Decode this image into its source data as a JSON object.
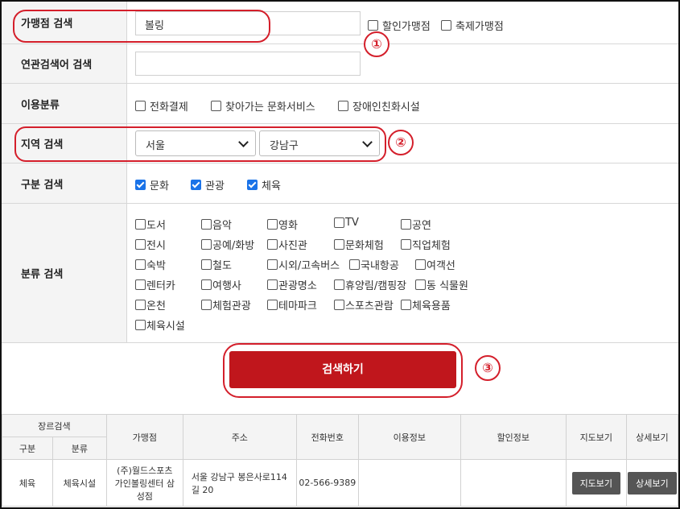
{
  "form": {
    "merchant": {
      "label": "가맹점 검색",
      "value": "볼링",
      "options": [
        "할인가맹점",
        "축제가맹점"
      ]
    },
    "related": {
      "label": "연관검색어 검색",
      "value": ""
    },
    "usage": {
      "label": "이용분류",
      "options": [
        "전화결제",
        "찾아가는 문화서비스",
        "장애인친화시설"
      ]
    },
    "region": {
      "label": "지역 검색",
      "city": "서울",
      "district": "강남구"
    },
    "division": {
      "label": "구분 검색",
      "options": [
        "문화",
        "관광",
        "체육"
      ]
    },
    "category": {
      "label": "분류 검색",
      "rows": [
        [
          "도서",
          "음악",
          "영화",
          "TV",
          "공연"
        ],
        [
          "전시",
          "공예/화방",
          "사진관",
          "문화체험",
          "직업체험"
        ],
        [
          "숙박",
          "철도",
          "시외/고속버스",
          "국내항공",
          "여객선"
        ],
        [
          "렌터카",
          "여행사",
          "관광명소",
          "휴양림/캠핑장",
          "동 식물원"
        ],
        [
          "온천",
          "체험관광",
          "테마파크",
          "스포츠관람",
          "체육용품"
        ],
        [
          "체육시설"
        ]
      ]
    },
    "search_button": "검색하기"
  },
  "markers": [
    "①",
    "②",
    "③"
  ],
  "table": {
    "headers": {
      "genre": "장르검색",
      "type": "구분",
      "class": "분류",
      "merchant": "가맹점",
      "address": "주소",
      "phone": "전화번호",
      "usage": "이용정보",
      "discount": "할인정보",
      "map": "지도보기",
      "detail": "상세보기"
    },
    "row": {
      "type": "체육",
      "class": "체육시설",
      "merchant": "(주)월드스포츠가인볼링센터 삼성점",
      "address": "서울 강남구 봉은사로114길 20",
      "phone": "02-566-9389",
      "usage": "",
      "discount": "",
      "map_btn": "지도보기",
      "detail_btn": "상세보기"
    }
  }
}
